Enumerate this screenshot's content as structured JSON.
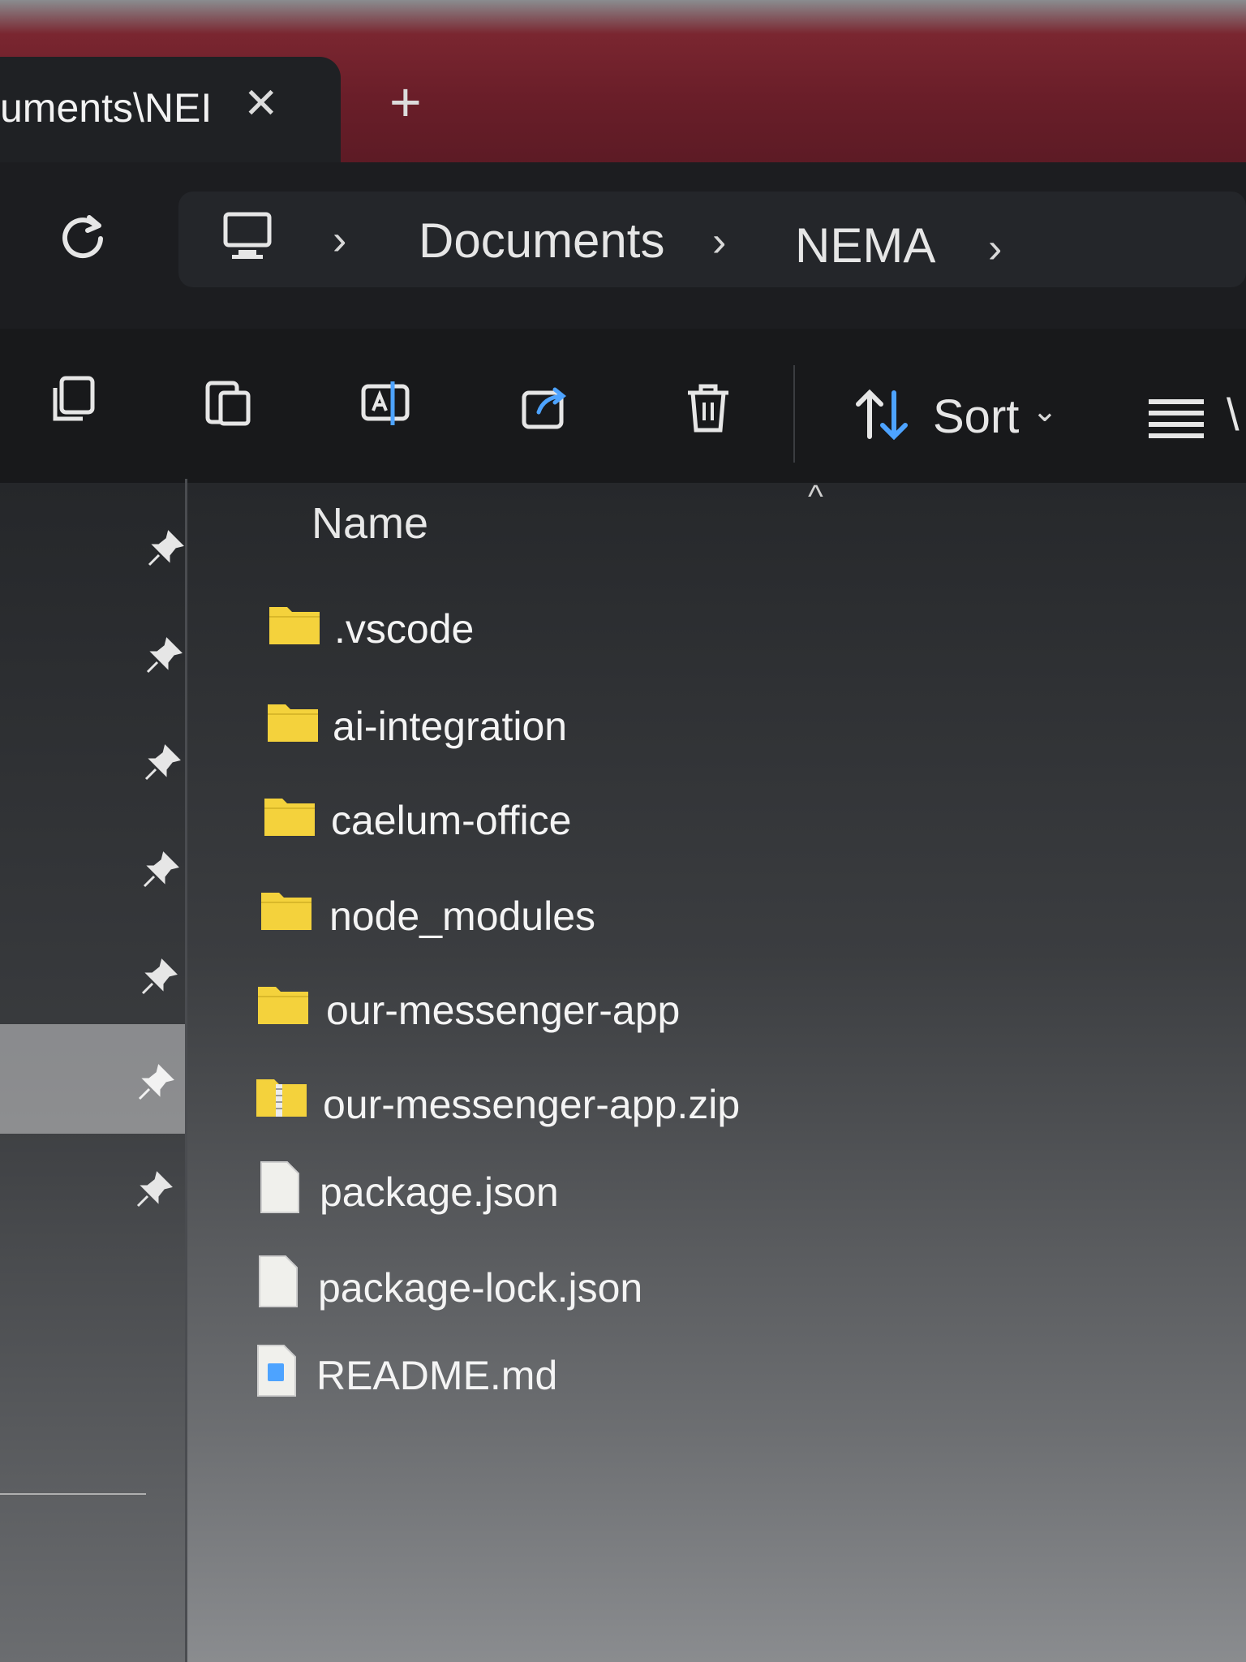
{
  "window": {
    "tab_title": "uments\\NEI",
    "new_tab_symbol": "+"
  },
  "address": {
    "crumbs": [
      "Documents",
      "NEMA"
    ]
  },
  "toolbar": {
    "sort_label": "Sort"
  },
  "file_list": {
    "column_name": "Name",
    "items": [
      {
        "name": ".vscode",
        "type": "folder"
      },
      {
        "name": "ai-integration",
        "type": "folder"
      },
      {
        "name": "caelum-office",
        "type": "folder"
      },
      {
        "name": "node_modules",
        "type": "folder"
      },
      {
        "name": "our-messenger-app",
        "type": "folder"
      },
      {
        "name": "our-messenger-app.zip",
        "type": "zip"
      },
      {
        "name": "package.json",
        "type": "file"
      },
      {
        "name": "package-lock.json",
        "type": "file"
      },
      {
        "name": "README.md",
        "type": "file"
      }
    ]
  },
  "colors": {
    "folder": "#f4d23c",
    "title_bar_accent": "#6a1e29",
    "icon_blue": "#4da3ff"
  },
  "icons": {
    "pin": "pin-icon",
    "folder": "folder-icon",
    "file": "file-icon"
  }
}
